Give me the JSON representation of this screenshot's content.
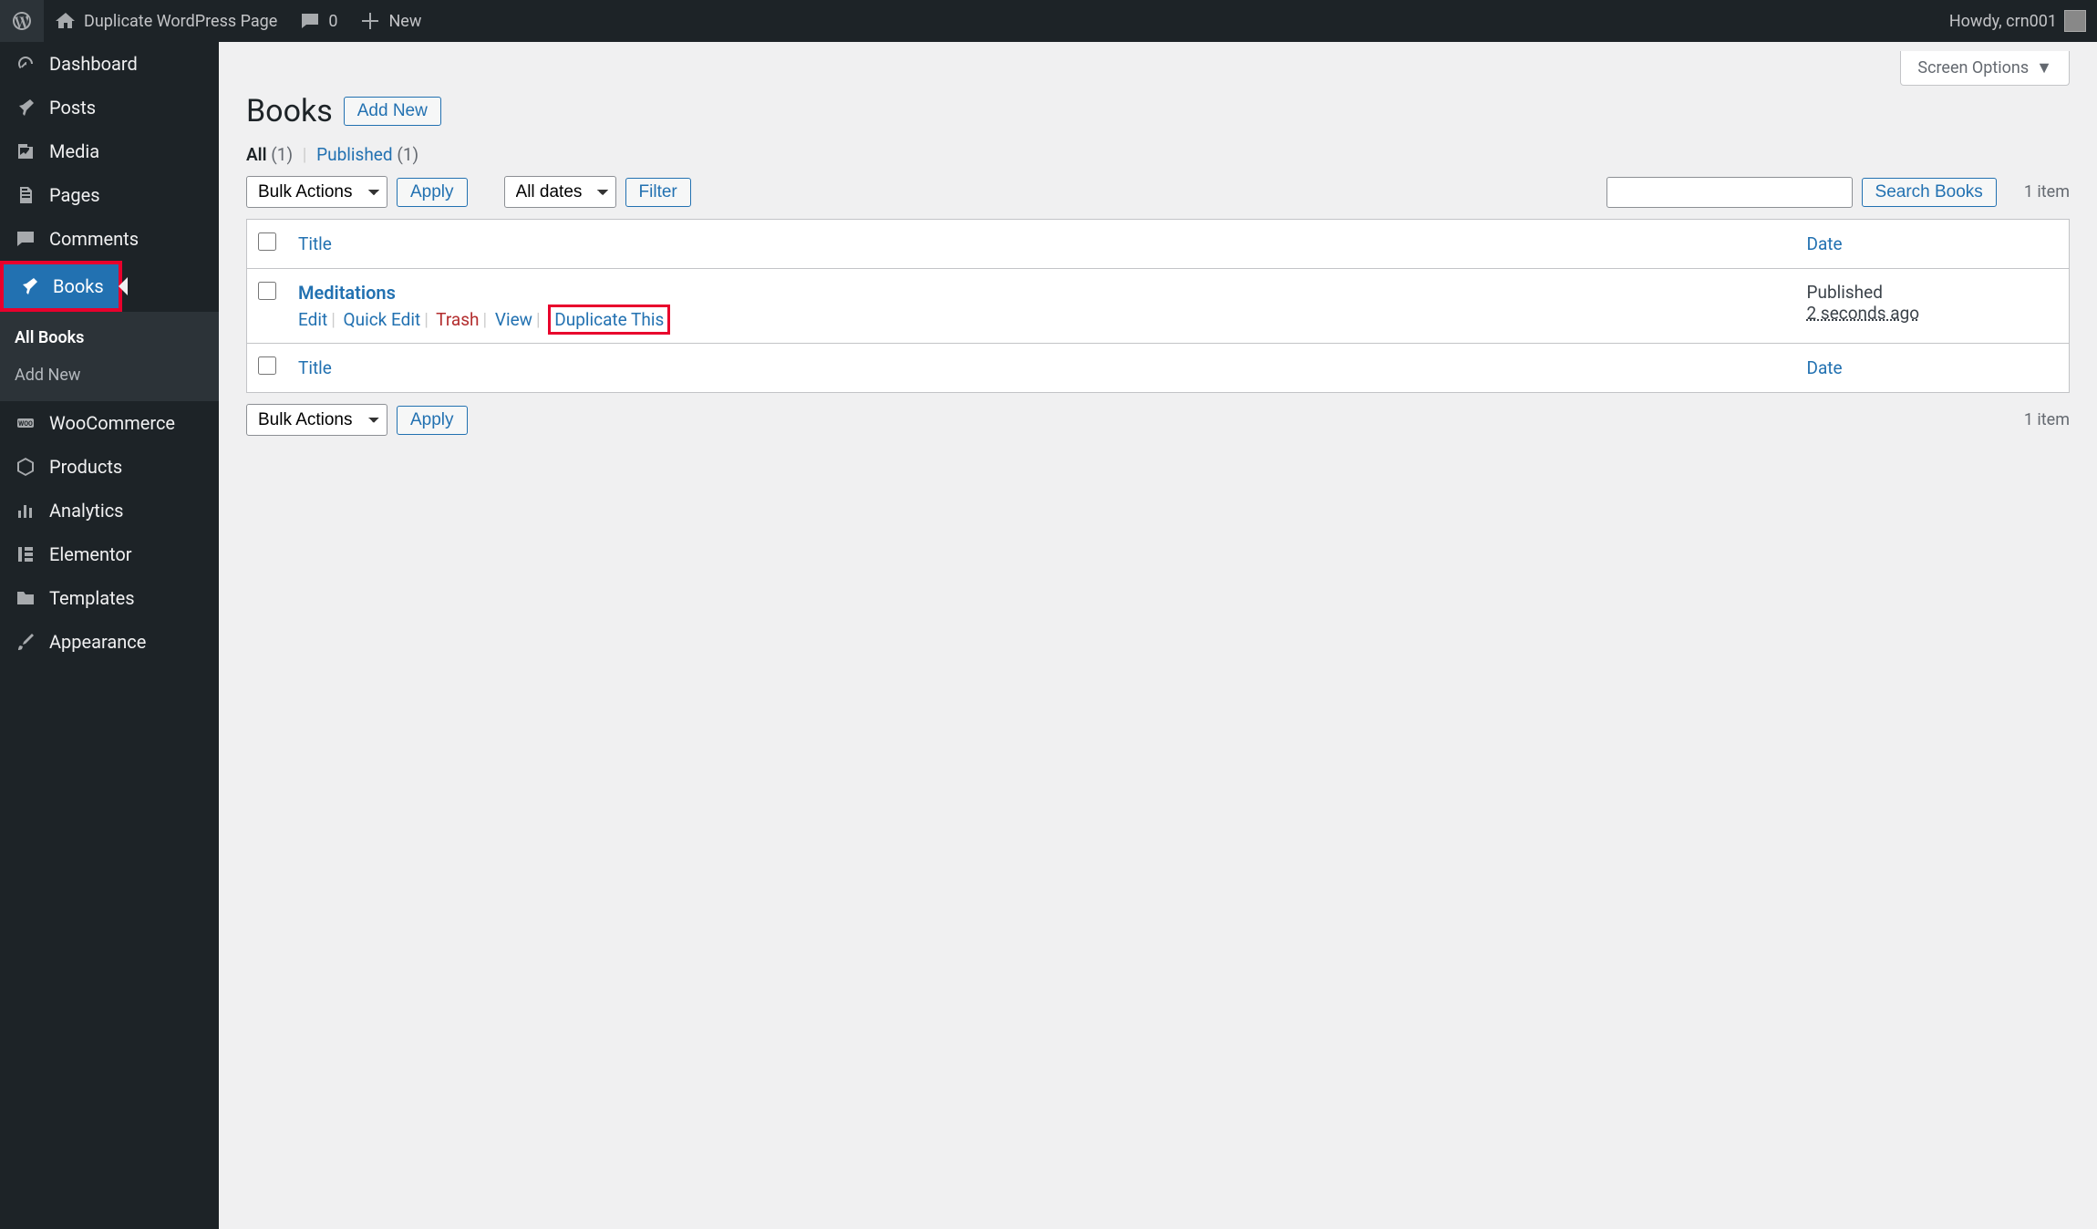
{
  "toolbar": {
    "site_title": "Duplicate WordPress Page",
    "comments_count": "0",
    "new_label": "New",
    "howdy": "Howdy, crn001"
  },
  "sidebar": {
    "items": [
      {
        "id": "dashboard",
        "label": "Dashboard",
        "icon": "gauge"
      },
      {
        "id": "posts",
        "label": "Posts",
        "icon": "pin"
      },
      {
        "id": "media",
        "label": "Media",
        "icon": "media"
      },
      {
        "id": "pages",
        "label": "Pages",
        "icon": "pages"
      },
      {
        "id": "comments",
        "label": "Comments",
        "icon": "comment"
      },
      {
        "id": "books",
        "label": "Books",
        "icon": "pin",
        "current": true,
        "highlight": true
      },
      {
        "id": "woocommerce",
        "label": "WooCommerce",
        "icon": "woo"
      },
      {
        "id": "products",
        "label": "Products",
        "icon": "box"
      },
      {
        "id": "analytics",
        "label": "Analytics",
        "icon": "bars"
      },
      {
        "id": "elementor",
        "label": "Elementor",
        "icon": "elementor"
      },
      {
        "id": "templates",
        "label": "Templates",
        "icon": "folder"
      },
      {
        "id": "appearance",
        "label": "Appearance",
        "icon": "brush"
      }
    ],
    "submenu": {
      "all": "All Books",
      "add": "Add New"
    }
  },
  "screen_options": "Screen Options",
  "page": {
    "title": "Books",
    "add_new": "Add New"
  },
  "filters": {
    "all_label": "All",
    "all_count": "(1)",
    "published_label": "Published",
    "published_count": "(1)"
  },
  "bulk_actions": "Bulk Actions",
  "apply": "Apply",
  "dates_filter": "All dates",
  "filter": "Filter",
  "search": {
    "value": "",
    "button": "Search Books"
  },
  "items_count": "1 item",
  "columns": {
    "title": "Title",
    "date": "Date"
  },
  "rows": [
    {
      "title": "Meditations",
      "actions": {
        "edit": "Edit",
        "quick_edit": "Quick Edit",
        "trash": "Trash",
        "view": "View",
        "duplicate": "Duplicate This"
      },
      "status": "Published",
      "time": "2 seconds ago"
    }
  ]
}
